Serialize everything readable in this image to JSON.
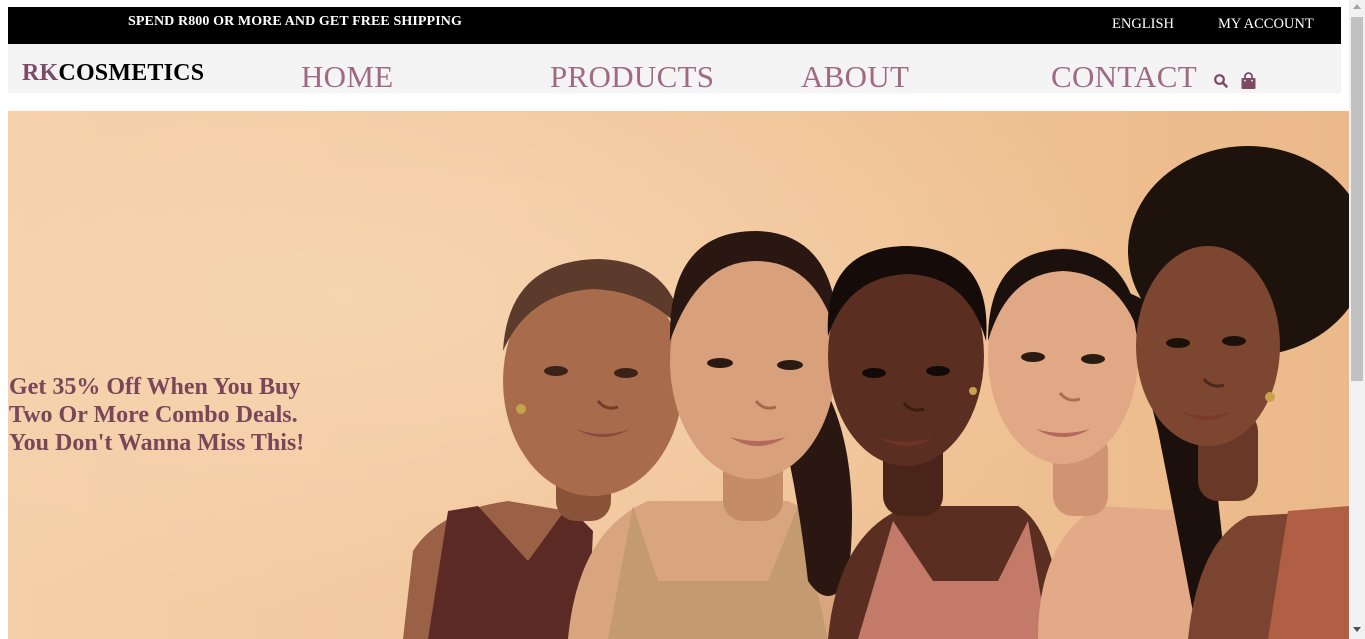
{
  "topbar": {
    "promo": "SPEND R800 OR MORE AND GET FREE SHIPPING",
    "language": "ENGLISH",
    "account": "MY ACCOUNT"
  },
  "navbar": {
    "logo_prefix": "RK",
    "logo_suffix": "COSMETICS",
    "links": [
      "HOME",
      "PRODUCTS",
      "ABOUT",
      "CONTACT"
    ],
    "icons": [
      "search-icon",
      "shopping-bag-icon"
    ]
  },
  "hero": {
    "lines": [
      "Get 35% Off When You Buy",
      "Two Or More Combo Deals.",
      "You Don't Wanna Miss This!"
    ]
  },
  "colors": {
    "brand": "#7e4a66",
    "nav_link": "#a06a85",
    "hero_text": "#7a4659",
    "hero_bg": "#f2c89f"
  }
}
